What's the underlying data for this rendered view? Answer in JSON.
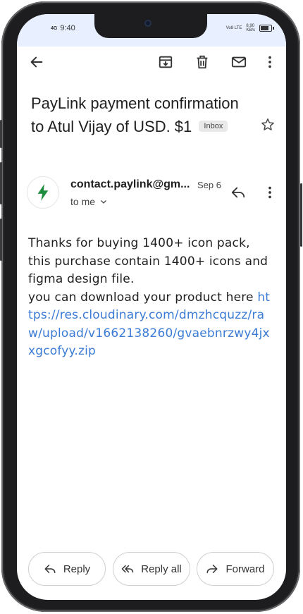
{
  "status_bar": {
    "network": "4G",
    "time": "9:40",
    "right_speed": "8.90",
    "right_speed_unit": "KB/s",
    "right_net": "Vo8 LTE"
  },
  "toolbar": {
    "back_icon": "arrow-left-icon",
    "archive_icon": "archive-icon",
    "delete_icon": "trash-icon",
    "mark_unread_icon": "mail-icon",
    "more_icon": "more-vertical-icon"
  },
  "email": {
    "subject": "PayLink payment confirmation to Atul Vijay of USD. $1",
    "label": "Inbox",
    "sender": "contact.paylink@gm...",
    "date": "Sep 6",
    "recipient": "to me",
    "body_text": "Thanks for buying 1400+ icon pack, this purchase contain 1400+ icons and figma design file.",
    "body_text2": "you can download your product here ",
    "link": "https://res.cloudinary.com/dmzhcquzz/raw/upload/v1662138260/gvaebnrzwy4jxxgcofyy.zip",
    "accent_color": "#3a7bd5",
    "avatar_color": "#1e8e3e"
  },
  "actions": {
    "reply": "Reply",
    "reply_all": "Reply all",
    "forward": "Forward"
  }
}
